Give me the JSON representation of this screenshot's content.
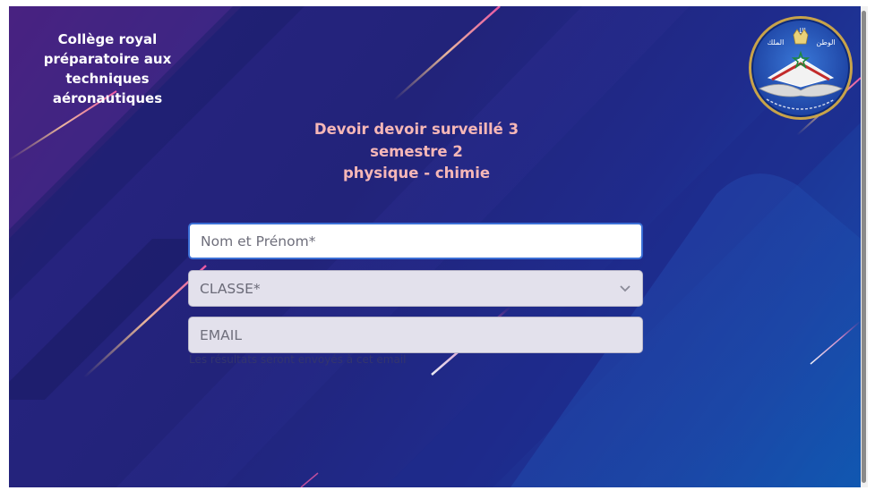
{
  "header": {
    "school_name": [
      "Collège royal",
      "préparatoire aux",
      "techniques",
      "aéronautiques"
    ],
    "logo": {
      "icon": "school-crest-logo",
      "arabic_text": [
        "الله",
        "الوطن",
        "الملك"
      ]
    }
  },
  "exam": {
    "title_lines": [
      "Devoir devoir surveillé 3",
      "semestre 2",
      "physique - chimie"
    ]
  },
  "form": {
    "name_field": {
      "placeholder": "Nom et Prénom*",
      "value": ""
    },
    "class_field": {
      "selected": "CLASSE*",
      "icon": "chevron-down-icon"
    },
    "email_field": {
      "placeholder": "EMAIL",
      "value": ""
    },
    "email_helper": "Les résultats seront envoyés à cet email"
  },
  "colors": {
    "title": "#f6b7b7",
    "school_name": "#ffffff",
    "field_bg": "#e3e1ec",
    "focus_border": "#3b6fd6"
  }
}
